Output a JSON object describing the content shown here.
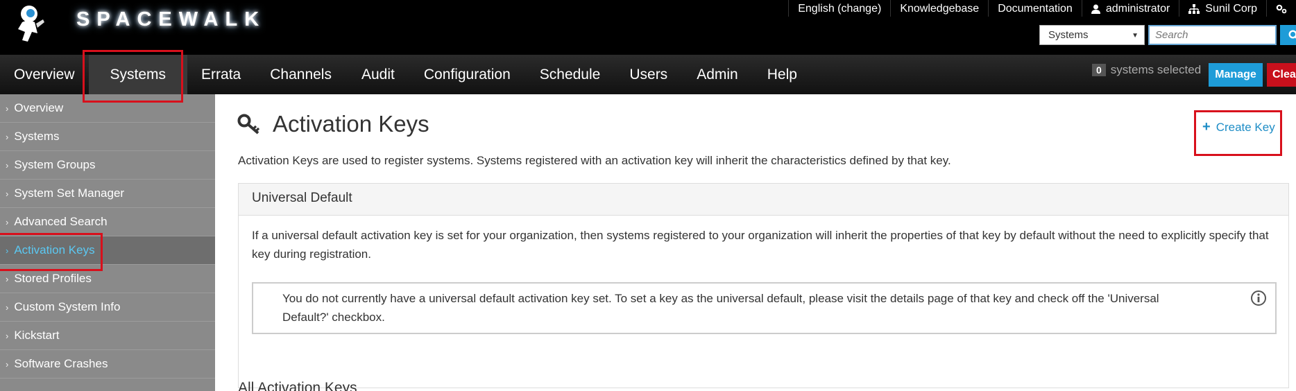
{
  "app": {
    "name": "SPACEWALK"
  },
  "top_links": [
    {
      "label": "English (change)",
      "icon": ""
    },
    {
      "label": "Knowledgebase",
      "icon": ""
    },
    {
      "label": "Documentation",
      "icon": ""
    },
    {
      "label": "administrator",
      "icon": "user-icon"
    },
    {
      "label": "Sunil Corp",
      "icon": "org-icon"
    },
    {
      "label": "",
      "icon": "settings-icon"
    }
  ],
  "search": {
    "scope": "Systems",
    "placeholder": "Search"
  },
  "nav": {
    "items": [
      "Overview",
      "Systems",
      "Errata",
      "Channels",
      "Audit",
      "Configuration",
      "Schedule",
      "Users",
      "Admin",
      "Help"
    ],
    "active": "Systems"
  },
  "selection": {
    "count": "0",
    "label": "systems selected",
    "manage": "Manage",
    "clear": "Clear"
  },
  "sidebar": {
    "items": [
      "Overview",
      "Systems",
      "System Groups",
      "System Set Manager",
      "Advanced Search",
      "Activation Keys",
      "Stored Profiles",
      "Custom System Info",
      "Kickstart",
      "Software Crashes"
    ],
    "active": "Activation Keys"
  },
  "main": {
    "title": "Activation Keys",
    "create_label": "Create Key",
    "description": "Activation Keys are used to register systems. Systems registered with an activation key will inherit the characteristics defined by that key.",
    "panel_title": "Universal Default",
    "panel_text": "If a universal default activation key is set for your organization, then systems registered to your organization will inherit the properties of that key by default without the need to explicitly specify that key during registration.",
    "info_text": "You do not currently have a universal default activation key set. To set a key as the universal default, please visit the details page of that key and check off the 'Universal Default?' checkbox.",
    "section_title": "All Activation Keys"
  },
  "colors": {
    "accent": "#1e9cd8",
    "highlight": "#d8101c",
    "sidebar": "#8a8a8a",
    "active_link": "#5bc8f2"
  }
}
